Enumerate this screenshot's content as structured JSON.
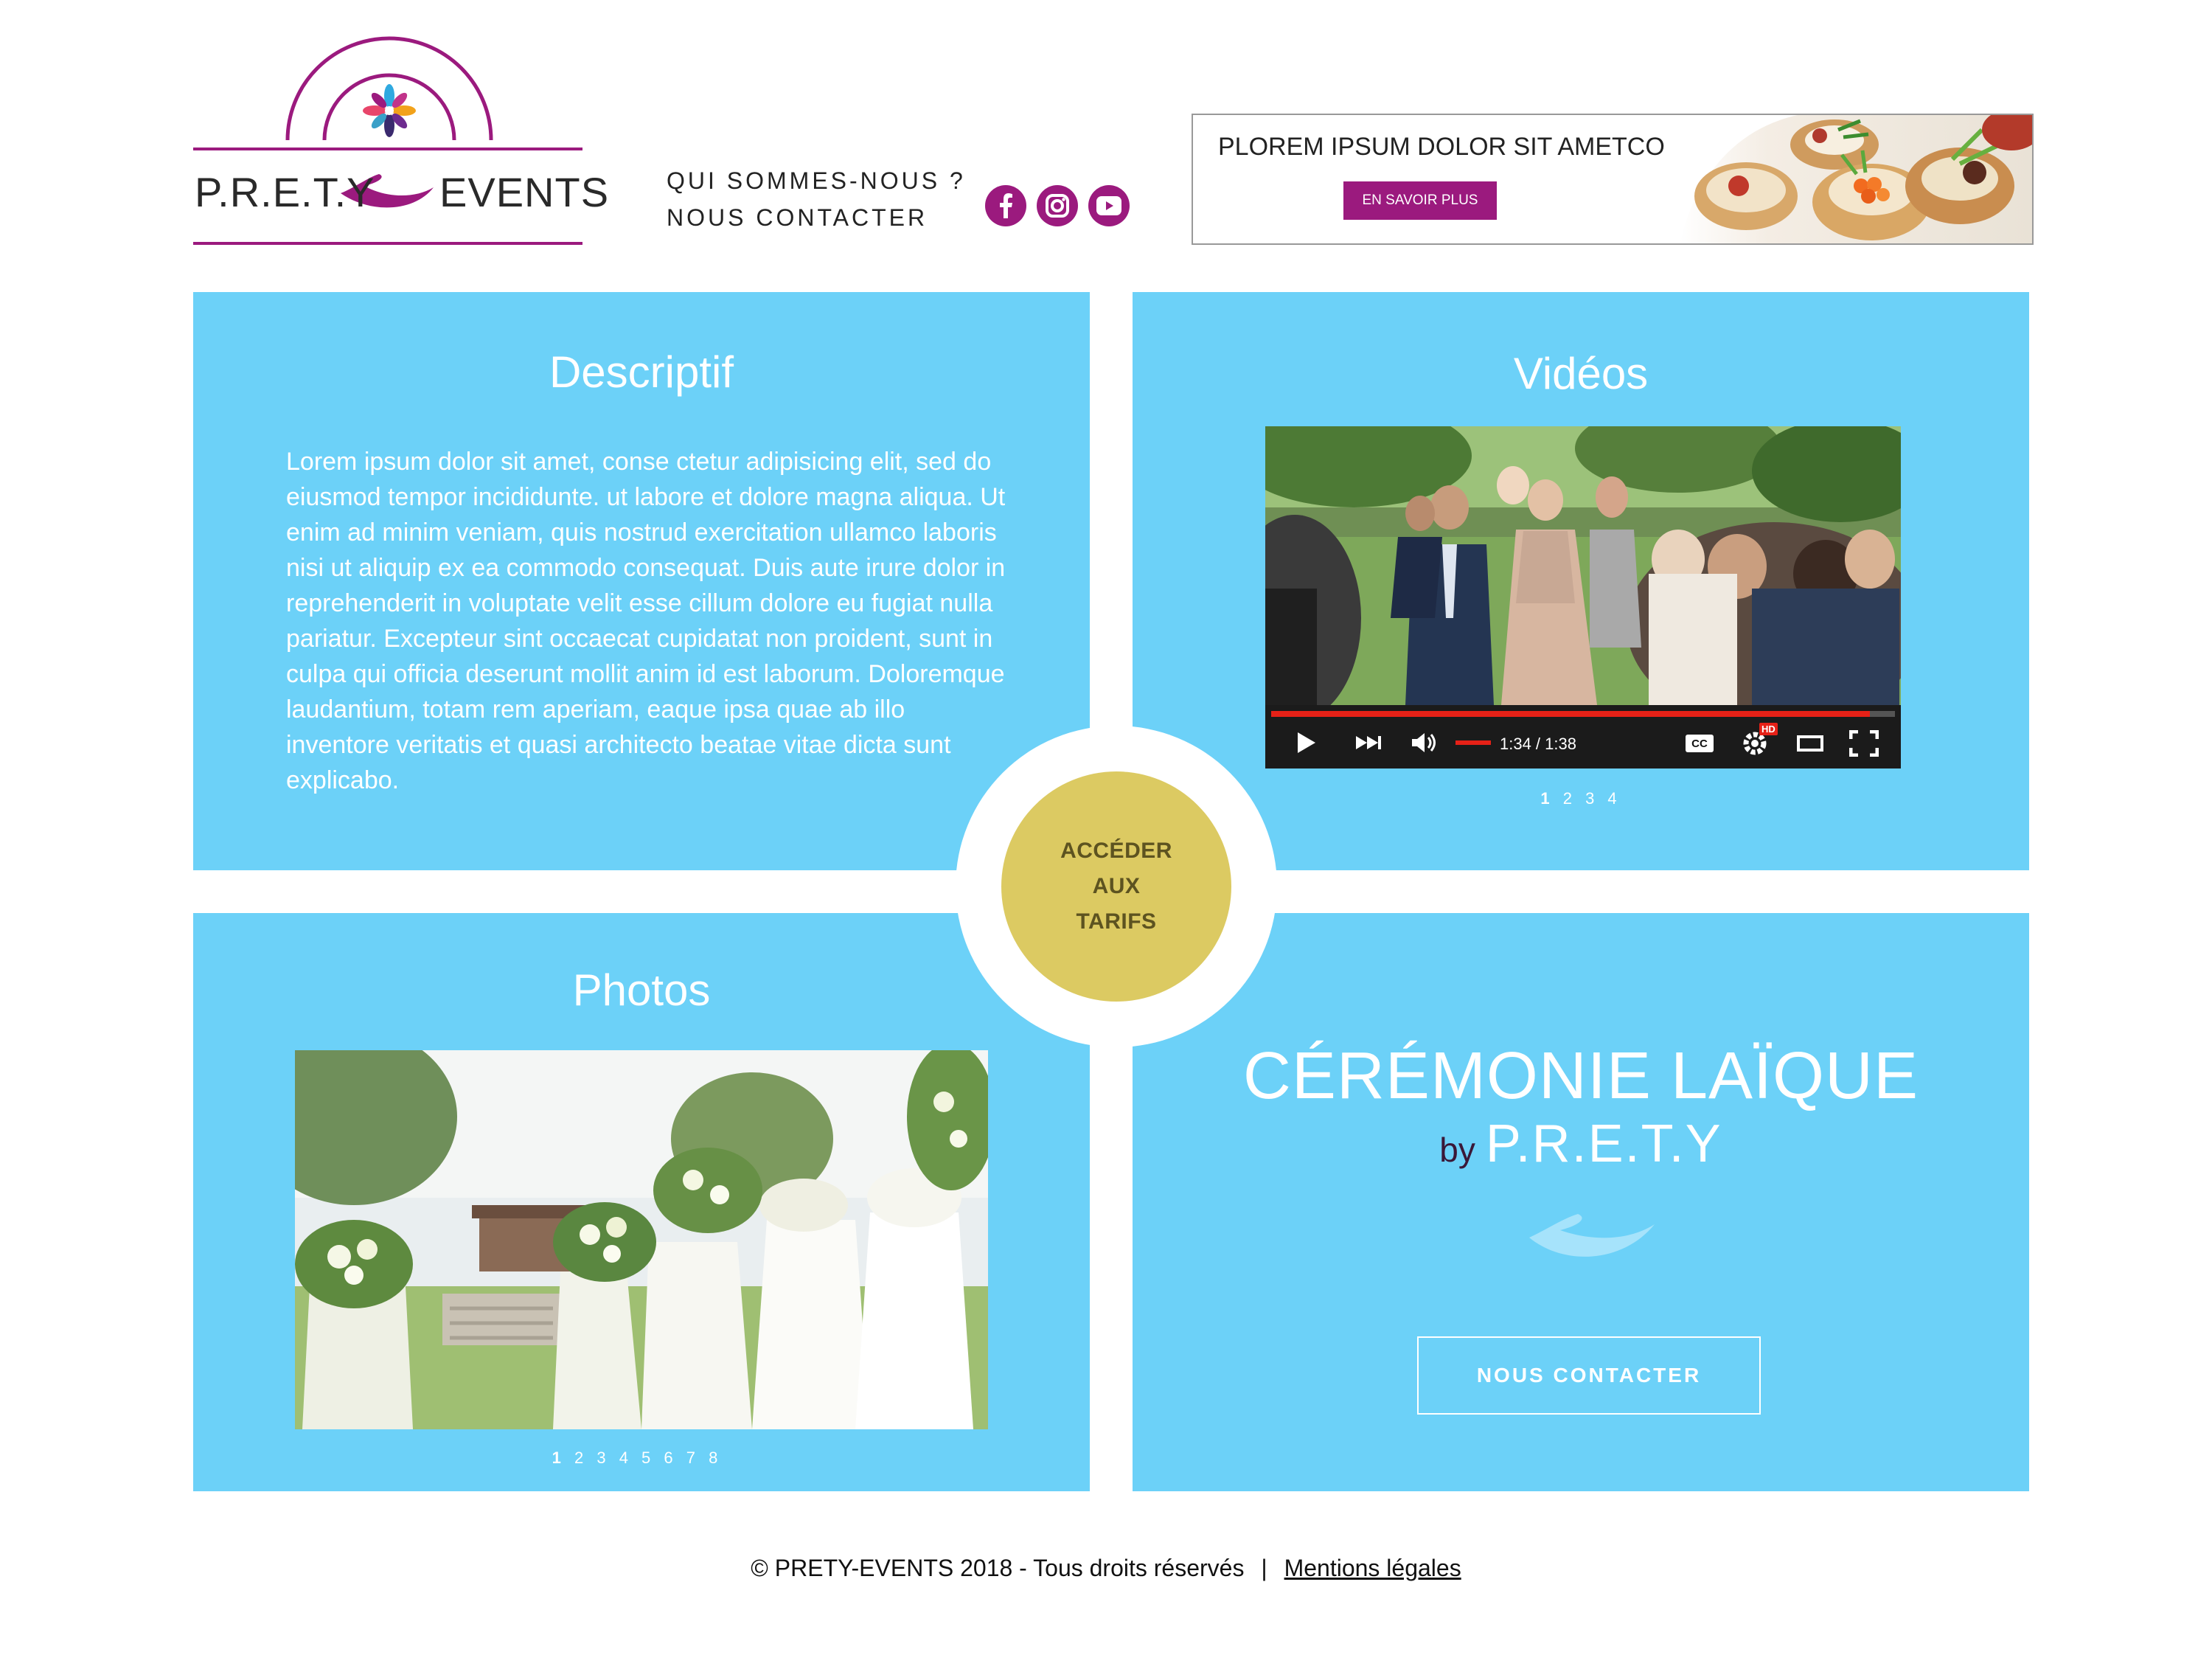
{
  "header": {
    "logo": {
      "left_word": "P.R.E.T.Y",
      "right_word": "EVENTS"
    },
    "nav": [
      {
        "label": "QUI SOMMES-NOUS ?"
      },
      {
        "label": "NOUS CONTACTER"
      }
    ],
    "social": [
      {
        "icon": "facebook-icon"
      },
      {
        "icon": "instagram-icon"
      },
      {
        "icon": "youtube-icon"
      }
    ],
    "banner": {
      "title": "PLOREM IPSUM DOLOR SIT AMETCO",
      "button_label": "EN SAVOIR PLUS"
    }
  },
  "descriptif": {
    "title": "Descriptif",
    "text": "Lorem ipsum dolor sit amet, conse ctetur adipisicing elit, sed do eiusmod tempor incididunte. ut labore et dolore magna aliqua. Ut enim ad minim veniam, quis nostrud exercitation ullamco laboris nisi ut aliquip ex ea commodo consequat. Duis aute irure dolor in reprehenderit in voluptate velit esse cillum dolore eu fugiat nulla pariatur. Excepteur sint occaecat cupidatat non proident, sunt in culpa qui officia deserunt mollit anim id est laborum. Doloremque laudantium, totam rem aperiam, eaque ipsa quae ab illo inventore veritatis et quasi architecto beatae vitae dicta sunt explicabo."
  },
  "videos": {
    "title": "Vidéos",
    "player": {
      "time": "1:34 / 1:38",
      "progress": 0.96,
      "cc_label": "CC",
      "hd_label": "HD"
    },
    "pager": {
      "current": "1",
      "others": "2 3 4"
    }
  },
  "photos": {
    "title": "Photos",
    "pager": {
      "current": "1",
      "others": "2 3 4 5 6 7 8"
    }
  },
  "ceremonie": {
    "title": "CÉRÉMONIE LAÏQUE",
    "by": "by",
    "brand": "P.R.E.T.Y",
    "button_label": "NOUS CONTACTER"
  },
  "cta_circle": {
    "line1": "ACCÉDER",
    "line2": "AUX",
    "line3": "TARIFS"
  },
  "footer": {
    "copyright": "© PRETY-EVENTS 2018 - Tous droits réservés",
    "separator": "|",
    "legal_link": "Mentions légales"
  },
  "colors": {
    "brand_purple": "#9b1a7e",
    "panel_blue": "#6cd1f8",
    "cta_gold": "#dcca62"
  }
}
